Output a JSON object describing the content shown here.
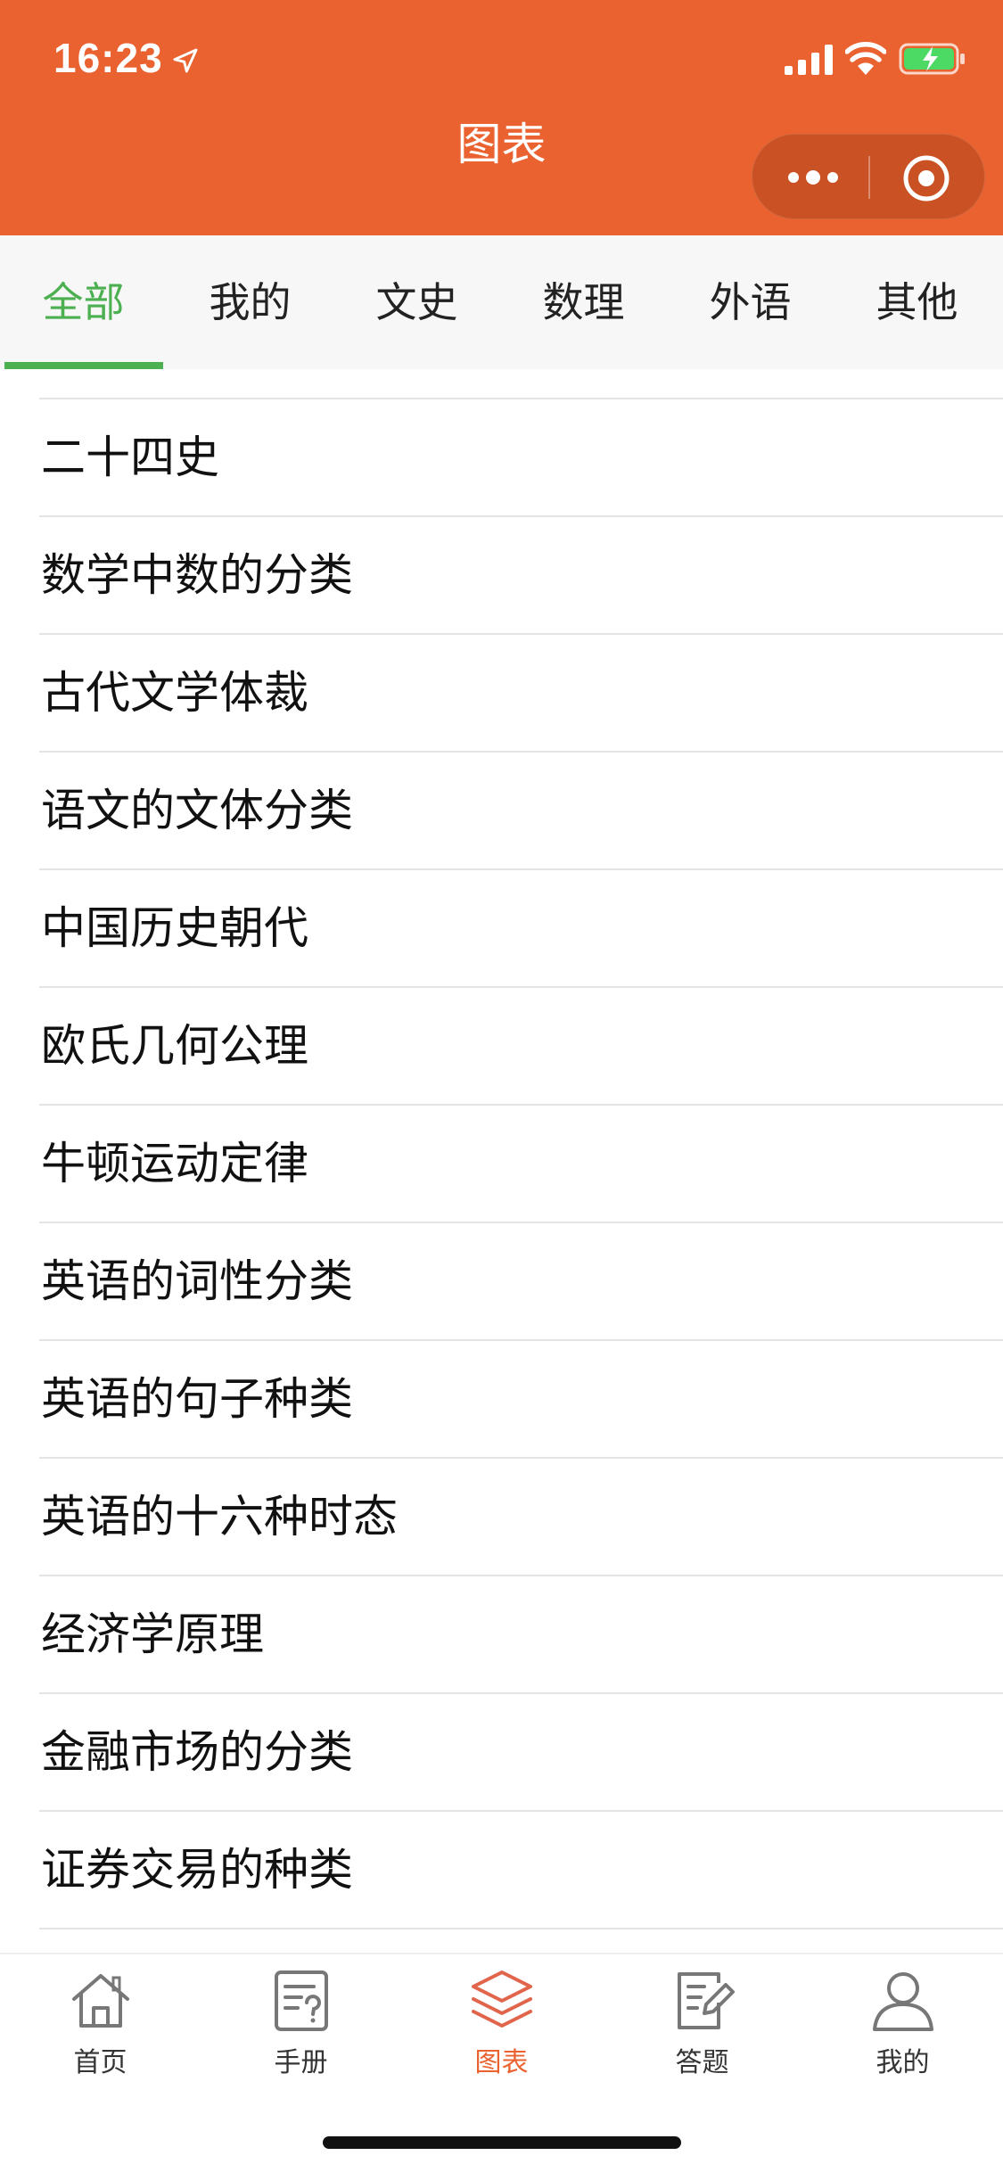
{
  "status_bar": {
    "time": "16:23",
    "icons": [
      "location-arrow-icon",
      "signal-icon",
      "wifi-icon",
      "battery-charging-icon"
    ]
  },
  "header": {
    "title": "图表",
    "background_color": "#ea622f",
    "capsule_icons": [
      "more-icon",
      "close-target-icon"
    ]
  },
  "tabs": {
    "items": [
      "全部",
      "我的",
      "文史",
      "数理",
      "外语",
      "其他"
    ],
    "active_index": 0,
    "active_color": "#4caf50"
  },
  "list": {
    "items": [
      "二十四史",
      "数学中数的分类",
      "古代文学体裁",
      "语文的文体分类",
      "中国历史朝代",
      "欧氏几何公理",
      "牛顿运动定律",
      "英语的词性分类",
      "英语的句子种类",
      "英语的十六种时态",
      "经济学原理",
      "金融市场的分类",
      "证券交易的种类"
    ]
  },
  "tabbar": {
    "items": [
      {
        "label": "首页",
        "icon": "home-icon"
      },
      {
        "label": "手册",
        "icon": "manual-icon"
      },
      {
        "label": "图表",
        "icon": "layers-icon"
      },
      {
        "label": "答题",
        "icon": "quiz-edit-icon"
      },
      {
        "label": "我的",
        "icon": "profile-icon"
      }
    ],
    "active_index": 2,
    "active_color": "#ea622f"
  }
}
